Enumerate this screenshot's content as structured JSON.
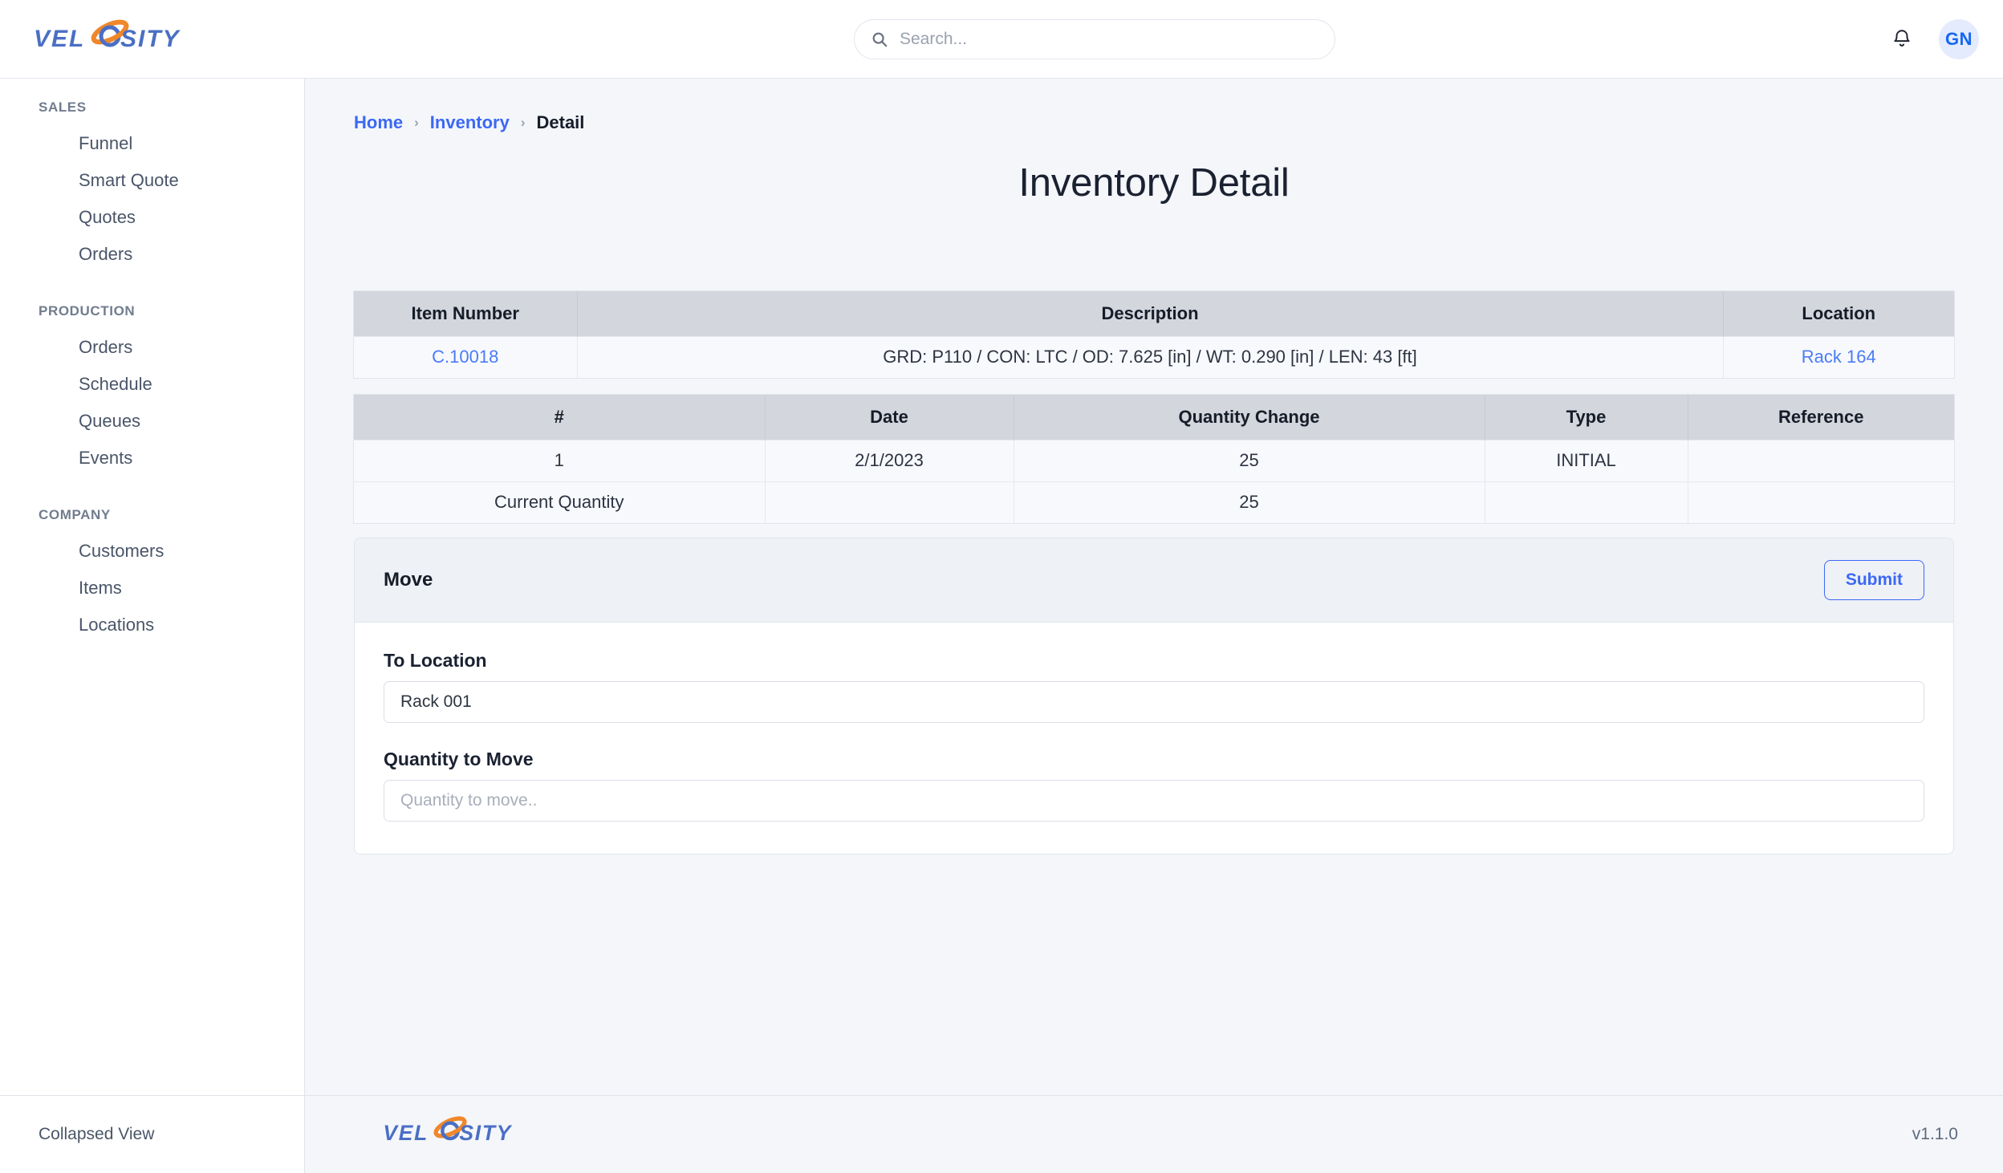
{
  "app": {
    "brand_name": "VELOSITY",
    "version": "v1.1.0"
  },
  "topbar": {
    "search": {
      "placeholder": "Search...",
      "value": "",
      "icon": "search-icon"
    },
    "notifications_icon": "bell-icon",
    "avatar_initials": "GN"
  },
  "sidebar": {
    "groups": [
      {
        "label": "SALES",
        "items": [
          {
            "label": "Funnel"
          },
          {
            "label": "Smart Quote"
          },
          {
            "label": "Quotes"
          },
          {
            "label": "Orders"
          }
        ]
      },
      {
        "label": "PRODUCTION",
        "items": [
          {
            "label": "Orders"
          },
          {
            "label": "Schedule"
          },
          {
            "label": "Queues"
          },
          {
            "label": "Events"
          }
        ]
      },
      {
        "label": "COMPANY",
        "items": [
          {
            "label": "Customers"
          },
          {
            "label": "Items"
          },
          {
            "label": "Locations"
          }
        ]
      }
    ],
    "footer_toggle": "Collapsed View"
  },
  "breadcrumb": {
    "items": [
      {
        "label": "Home",
        "link": true
      },
      {
        "label": "Inventory",
        "link": true
      },
      {
        "label": "Detail",
        "link": false
      }
    ],
    "separator": "›"
  },
  "page": {
    "title": "Inventory Detail"
  },
  "item_table": {
    "headers": [
      "Item Number",
      "Description",
      "Location"
    ],
    "rows": [
      {
        "item_number": "C.10018",
        "description": "GRD: P110 / CON: LTC / OD: 7.625 [in] / WT: 0.290 [in] / LEN: 43 [ft]",
        "location": "Rack 164"
      }
    ]
  },
  "history_table": {
    "headers": [
      "#",
      "Date",
      "Quantity Change",
      "Type",
      "Reference"
    ],
    "rows": [
      {
        "num": "1",
        "date": "2/1/2023",
        "quantity_change": "25",
        "type": "INITIAL",
        "reference": ""
      }
    ],
    "summary_row": {
      "label": "Current Quantity",
      "date": "",
      "quantity_change": "25",
      "type": "",
      "reference": ""
    }
  },
  "move_card": {
    "title": "Move",
    "submit_label": "Submit",
    "to_location": {
      "label": "To Location",
      "value": "Rack 001"
    },
    "quantity_to_move": {
      "label": "Quantity to Move",
      "value": "",
      "placeholder": "Quantity to move.."
    }
  },
  "colors": {
    "accent_blue": "#3b68f5",
    "link_blue": "#4a7cf7",
    "brand_orange": "#f0872a",
    "table_header_gray": "#d3d6dc",
    "page_bg": "#f4f6fa"
  }
}
